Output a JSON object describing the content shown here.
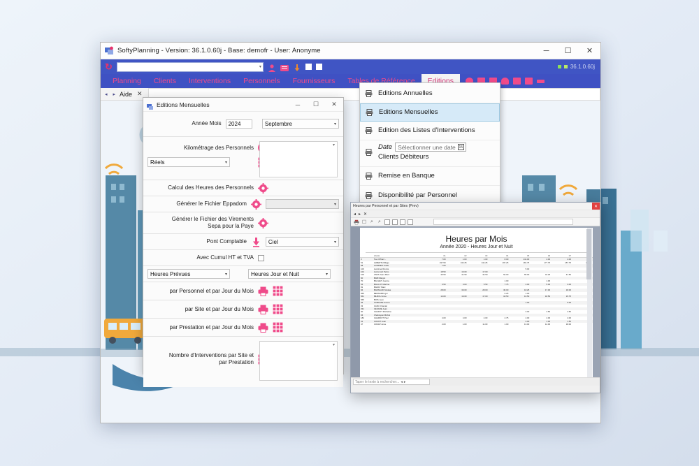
{
  "app_window": {
    "title": "SoftyPlanning - Version: 36.1.0.60j - Base: demofr - User: Anonyme",
    "icon": "app-icon",
    "minimize": "─",
    "maximize": "☐",
    "close": "✕",
    "version_badge": "36.1.0.60j"
  },
  "toolbar": {
    "refresh_icon": "refresh-icon",
    "search_value": "",
    "search_placeholder": "",
    "dropdown_caret": "▾",
    "icons": [
      "person-icon",
      "list-icon",
      "download-icon",
      "square-icon",
      "square-icon"
    ]
  },
  "menu": {
    "items": [
      {
        "label": "Planning",
        "active": false
      },
      {
        "label": "Clients",
        "active": false
      },
      {
        "label": "Interventions",
        "active": false
      },
      {
        "label": "Personnels",
        "active": false
      },
      {
        "label": "Fournisseurs",
        "active": false
      },
      {
        "label": "Tables de Référence",
        "active": false
      },
      {
        "label": "Editions",
        "active": true
      }
    ],
    "ribbon_icons": [
      "clock-icon",
      "briefcase-icon",
      "folder-icon",
      "alert-icon",
      "calendar-icon",
      "users-icon",
      "link-icon"
    ]
  },
  "tab_strip": {
    "prev": "◂",
    "next": "▸",
    "tab_label": "Aide",
    "close": "✕"
  },
  "editions_menu": {
    "items": [
      {
        "label": "Editions Annuelles",
        "icon": "printer-icon",
        "highlighted": false
      },
      {
        "label": "Editions Mensuelles",
        "icon": "printer-icon",
        "highlighted": true
      },
      {
        "label": "Edition des Listes d'Interventions",
        "icon": "printer-icon",
        "highlighted": false
      },
      {
        "label": "Clients Débiteurs",
        "icon": "printer-icon",
        "highlighted": false,
        "date_label": "Date",
        "date_placeholder": "Sélectionner une date",
        "calendar_icon": "calendar-icon"
      },
      {
        "label": "Remise en Banque",
        "icon": "printer-icon",
        "highlighted": false
      },
      {
        "label": "Disponibilité par Personnel",
        "icon": "printer-icon",
        "highlighted": false
      }
    ]
  },
  "dialog": {
    "title": "Editions Mensuelles",
    "icon": "dialog-icon",
    "minimize": "─",
    "maximize": "☐",
    "close": "✕",
    "year_label": "Année  Mois",
    "year_value": "2024",
    "month_value": "Septembre",
    "kilometrage_label": "Kilométrage des Personnels",
    "kilometrage_globe_icon": "globe-icon",
    "kilometrage_grid_icon": "grid-icon",
    "reels_value": "Réels",
    "calcul_heures_label": "Calcul des Heures des Personnels",
    "calcul_heures_icon": "gear-icon",
    "eppadom_label": "Générer le Fichier Eppadom",
    "eppadom_icon": "gear-icon",
    "eppadom_select_value": "",
    "sepa_label": "Générer le Fichier des Virements\nSepa pour la Paye",
    "sepa_label_line1": "Générer le Fichier des Virements",
    "sepa_label_line2": "Sepa pour la Paye",
    "sepa_icon": "gear-icon",
    "pont_comptable_label": "Pont Comptable",
    "pont_comptable_icon": "download-icon",
    "pont_comptable_value": "Ciel",
    "cumul_label": "Avec Cumul HT et TVA",
    "cumul_checked": false,
    "heures_prevues_value": "Heures Prévues",
    "heures_jour_nuit_value": "Heures Jour et Nuit",
    "print_rows": [
      {
        "label": "par Personnel et par Jour du Mois",
        "print_icon": "printer-icon",
        "grid_icon": "grid-icon"
      },
      {
        "label": "par Site et par Jour du Mois",
        "print_icon": "printer-icon",
        "grid_icon": "grid-icon"
      },
      {
        "label": "par Prestation et par Jour du Mois",
        "print_icon": "printer-icon",
        "grid_icon": "grid-icon"
      }
    ],
    "interventions_label_line1": "Nombre d'Interventions par Site et",
    "interventions_label_line2": "par Prestation",
    "interventions_grid_icon": "grid-icon"
  },
  "report": {
    "window_title": "Heures par Personnel et par Sites (Prev)",
    "close": "✕",
    "nav": [
      "◂",
      "▸",
      "✕"
    ],
    "toolbar_icons": [
      "print-icon",
      "page-icon",
      "zoom-in-icon",
      "zoom-out-icon",
      "page-layout-icon",
      "page-layout-icon",
      "page-layout-icon",
      "page-layout-icon"
    ],
    "heading": "Heures par Mois",
    "subheading": "Année 2020 - Heures Jour et Nuit",
    "find_placeholder": "Taper le texte à rechercher...",
    "columns": [
      "",
      "Libellé",
      "01",
      "02",
      "03",
      "04",
      "05",
      "06",
      "07",
      "08"
    ],
    "rows": [
      [
        "3",
        "Tian Offrant ..",
        "7.00",
        "1.00",
        "1.00",
        "8.00",
        "141.00",
        "4.00",
        "4.00",
        ""
      ],
      [
        "51",
        "ALBERTA Milage",
        "197.50",
        "132.25",
        "144.25",
        "197.25",
        "181.75",
        "177.75",
        "157.75",
        "148.50"
      ],
      [
        "58",
        "AUDRIED Joelle",
        "7.00",
        "",
        "",
        "",
        "",
        "",
        "",
        ""
      ],
      [
        "106",
        "Auzolmell Dorsis",
        "",
        "",
        "",
        "",
        "5.00",
        "",
        "",
        ""
      ],
      [
        "104",
        "Auzomord Petrio",
        "18.50",
        "16.00",
        "17.00",
        "",
        "",
        "",
        "",
        ""
      ],
      [
        "105",
        "ASNS Jean-Marc",
        "46.50",
        "41.50",
        "44.50",
        "52.00",
        "55.00",
        "44.25",
        "41.50",
        "43.50"
      ],
      [
        "60",
        "BABI Margot",
        "",
        "",
        "",
        "",
        "",
        "",
        "",
        ""
      ],
      [
        "70",
        "BACHET Joanna",
        "",
        "",
        "",
        "1.00",
        "",
        "1.00",
        "",
        ""
      ],
      [
        "54",
        "BAILLOT Martina",
        "3.50",
        "3.00",
        "5.50",
        "7.75",
        "4.00",
        "5.00",
        "3.00",
        "4.50"
      ],
      [
        "81",
        "BARAY Marc",
        "",
        "",
        "",
        "",
        "",
        "",
        "",
        ""
      ],
      [
        "84",
        "BARNAUD Nicolas",
        "28.00",
        "30.00",
        "28.00",
        "30.00",
        "18.25",
        "17.00",
        "18.00",
        "18.50"
      ],
      [
        "565",
        "BERNARD Igor",
        "",
        "",
        "",
        "6.25",
        "1.00",
        "",
        "",
        ""
      ],
      [
        "561",
        "BILBOU Anne",
        "14.00",
        "16.00",
        "17.00",
        "18.50",
        "16.50",
        "18.50",
        "15.75",
        "17.00"
      ],
      [
        "565",
        "BOIS Jean",
        "",
        "",
        "",
        "",
        "",
        "",
        "",
        ""
      ],
      [
        "36",
        "CABASSE Aurore",
        "",
        "",
        "",
        "",
        "1.00",
        "",
        "5.00",
        "12.50"
      ],
      [
        "33",
        "CARU Chantal",
        "",
        "",
        "",
        "",
        "",
        "",
        "",
        ""
      ],
      [
        "331",
        "CESARE Jean",
        "",
        "",
        "",
        "",
        "",
        "",
        "",
        ""
      ],
      [
        "30",
        "CHADOT Micheline",
        "",
        "",
        "",
        "",
        "3.00",
        "4.50",
        "4.50",
        "8.50"
      ],
      [
        "34",
        "Chabrayan Michel",
        "",
        "",
        "",
        "",
        "",
        "",
        "",
        ""
      ],
      [
        "184",
        "CHARDOT Paul",
        "4.00",
        "4.00",
        "4.00",
        "4.75",
        "4.00",
        "4.00",
        "4.00",
        "4.00"
      ],
      [
        "41",
        "COURT Jean",
        "",
        "",
        "",
        "",
        "2.00",
        "1.00",
        "1.50",
        "1.00"
      ],
      [
        "47",
        "COUET Anne",
        "2.00",
        "1.00",
        "11.00",
        "1.00",
        "13.00",
        "12.00",
        "18.00",
        "13.00"
      ]
    ]
  },
  "colors": {
    "ribbon_blue": "#3f51c3",
    "accent_pink": "#ef4b8a",
    "menu_highlight": "#d6eaf8",
    "close_red": "#e04040"
  }
}
